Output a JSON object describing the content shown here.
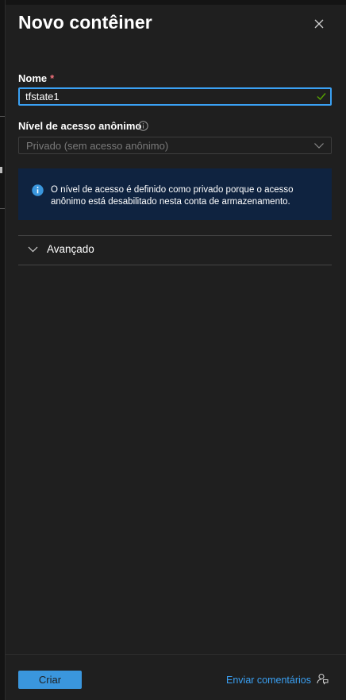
{
  "panel": {
    "title": "Novo contêiner",
    "close_icon": "close-icon"
  },
  "name_field": {
    "label": "Nome",
    "required_marker": "*",
    "value": "tfstate1",
    "valid_icon": "checkmark-icon"
  },
  "access_level": {
    "label": "Nível de acesso anônimo",
    "info_icon": "info-icon",
    "selected_value": "Privado (sem acesso anônimo)",
    "disabled": true
  },
  "infobar": {
    "icon": "info-filled-icon",
    "message": "O nível de acesso é definido como privado porque o acesso anônimo está desabilitado nesta conta de armazenamento."
  },
  "advanced": {
    "label": "Avançado",
    "expanded": false
  },
  "footer": {
    "create_label": "Criar",
    "feedback_label": "Enviar comentários",
    "feedback_icon": "feedback-icon"
  },
  "colors": {
    "accent": "#3aa0f3",
    "button": "#3a96dd",
    "required": "#f1707b",
    "infobar_bg": "#0f2340",
    "valid_check": "#57a300"
  }
}
